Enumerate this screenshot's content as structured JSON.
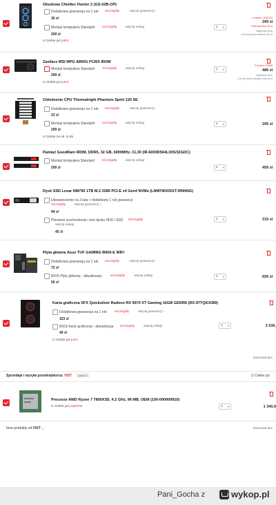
{
  "items": [
    {
      "title": "Obudowa Chieftec Hunter 2 (GS-02B-OP)",
      "options": [
        {
          "label": "Dodatkowa gwarancja na 1 rok",
          "details": "szczegóły",
          "more": "więcej gwarancji",
          "price": "30 zł"
        },
        {
          "label": "Montaż komputera Standard",
          "details": "szczegóły",
          "more": "więcej usług",
          "price": "209 zł"
        }
      ],
      "availability_prefix": "U Ciebie już",
      "availability_value": "jutro!",
      "qty": "1",
      "discount": "Z kodem: 2069129",
      "price": "269 zł",
      "saved": "Oszczędzasz: 35 zł",
      "lowest": [
        "Najniższa cena",
        "z 30 dni przed obniżką: 319 zł"
      ]
    },
    {
      "title": "Zasilacz MSI MPG A850G PCIE5 850W",
      "options": [
        {
          "label": "Montaż komputera Standard",
          "details": "szczegóły",
          "more": "więcej usług",
          "price": "209 zł"
        }
      ],
      "availability_prefix": "U Ciebie już",
      "availability_value": "jutro!",
      "qty": "1",
      "discount": "Z kodem: MSI85",
      "price": "489 zł",
      "lowest": [
        "Najniższa cena",
        "z 30 dni przed obniżką: 502,44 zł"
      ]
    },
    {
      "title": "Chłodzenie CPU Thermalright Phantom Spirit 120 SE",
      "options": [
        {
          "label": "Dodatkowa gwarancja na 1 rok",
          "details": "szczegóły",
          "more": "więcej gwarancji",
          "price": "23 zł"
        },
        {
          "label": "Montaż komputera Standard",
          "details": "szczegóły",
          "more": "więcej usług",
          "price": "209 zł"
        }
      ],
      "availability_prefix": "U Ciebie za ok.",
      "availability_value": "9 dni",
      "qty": "1",
      "price": "205 zł"
    },
    {
      "title": "Pamięć GoodRam IRDM, DDR5, 32 GB, 6000MHz, CL30 (IR-6000D564L30S/32GDC)",
      "options": [
        {
          "label": "Montaż komputera Standard",
          "details": "szczegóły",
          "more": "więcej usług",
          "price": "209 zł"
        }
      ],
      "qty": "1",
      "price": "459 zł"
    },
    {
      "title": "Dysk SSD Lexar NM790 1TB M.2 2280 PCI-E x4 Gen4 NVMe (LNM790X001T-RNNNG)",
      "options": [
        {
          "label": "Ubezpieczenie na 3 lata + dodatkowy 1 rok gwarancji",
          "details": "szczegóły",
          "more": "więcej gwarancji",
          "price": "94 zł"
        },
        {
          "label": "Pierwsze uruchomienie i test dysku HDD i SSD",
          "details": "szczegóły",
          "more": "więcej usług",
          "price": "45 zł"
        }
      ],
      "qty": "1",
      "price": "319 zł"
    },
    {
      "title": "Płyta główna Asus TUF GAMING B650-E WIFI",
      "options": [
        {
          "label": "Dodatkowa gwarancja na 1 rok",
          "details": "szczegóły",
          "more": "więcej gwarancji",
          "price": "72 zł"
        },
        {
          "label": "BIOS Płyty głównej - aktualizacja",
          "details": "szczegóły",
          "more": "więcej usług",
          "price": "50 zł"
        }
      ],
      "qty": "1",
      "price": "659 zł"
    },
    {
      "title": "Karta graficzna XFX Quicksilver Radeon RX 9070 XT Gaming 16GB GDDR6 (RX-97TQICKB9)",
      "options": [
        {
          "label": "Dodatkowa gwarancja na 1 rok",
          "details": "szczegóły",
          "more": "więcej gwarancji",
          "price": "323 zł"
        },
        {
          "label": "BIOS Karty graficznej - aktualizacja",
          "details": "szczegóły",
          "more": "więcej usług",
          "price": "49 zł"
        }
      ],
      "availability_prefix": "U Ciebie już",
      "availability_value": "jutro",
      "qty": "1",
      "price": "2 539,"
    }
  ],
  "delivery_free": "Darmowa dos",
  "seller": {
    "label": "Sprzedaje i wysyła przedsiębiorca:",
    "name": "VIST",
    "badge": "pakiet:2",
    "availability": "U Ciebie już"
  },
  "seller_item": {
    "title": "Procesor AMD Ryzen 7 7800X3D, 4.2 GHz, 96 MB, OEM (100-000000910)",
    "availability_prefix": "U Ciebie już",
    "availability_value": "pojutrze!",
    "qty": "1",
    "price": "1 340,9"
  },
  "other_products": {
    "prefix": "Inne produkty od",
    "name": "VIST"
  },
  "delivery_free_2": "Darmowa dos",
  "footer": {
    "username": "Pani_Gocha",
    "suffix": "z",
    "site": "wykop.pl"
  }
}
